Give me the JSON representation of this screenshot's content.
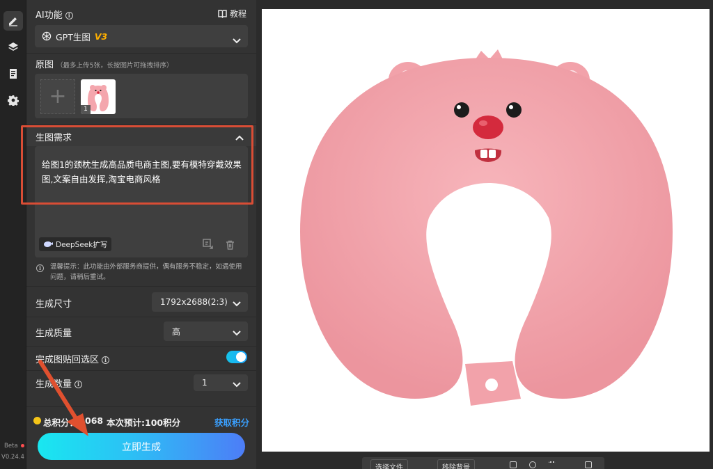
{
  "rail": {
    "items": [
      "edit",
      "layers",
      "document",
      "settings"
    ],
    "beta": "Beta",
    "version": "V0.24.4"
  },
  "ai": {
    "title": "AI功能",
    "tutorial": "教程",
    "model_name": "GPT生图",
    "model_version": "V3"
  },
  "source": {
    "title": "原图",
    "note": "（最多上传5张，长按图片可拖拽排序）",
    "thumb_index": "1"
  },
  "requirement": {
    "title": "生图需求",
    "text": "给图1的颈枕生成高品质电商主图,要有模特穿戴效果图,文案自由发挥,淘宝电商风格",
    "deepseek": "DeepSeek扩写",
    "notice": "温馨提示：此功能由外部服务商提供，偶有服务不稳定，如遇使用问题，请稍后重试。"
  },
  "settings": {
    "size_label": "生成尺寸",
    "size_value": "1792x2688(2:3)",
    "quality_label": "生成质量",
    "quality_value": "高",
    "paste_back_label": "完成图贴回选区",
    "paste_back_on": true,
    "count_label": "生成数量",
    "count_value": "1"
  },
  "footer": {
    "total_label": "总积分：",
    "total_value": "068",
    "estimate": "本次预计:100积分",
    "get_points": "获取积分",
    "generate": "立即生成"
  },
  "canvas_toolbar": {
    "select_file": "选择文件",
    "remove_bg": "移除背景"
  },
  "colors": {
    "accent": "#1ea7ff",
    "highlight": "#d94d35",
    "pillow": "#f4a6ad",
    "version_badge": "#ffb000"
  }
}
